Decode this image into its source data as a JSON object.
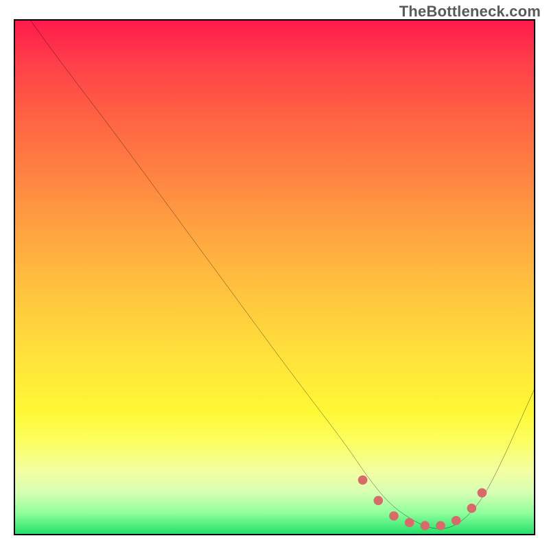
{
  "watermark": "TheBottleneck.com",
  "colors": {
    "border": "#000000",
    "curve": "#000000",
    "marker": "#d86a6a",
    "gradient_top": "#ff1a4b",
    "gradient_bottom": "#24e06a"
  },
  "chart_data": {
    "type": "line",
    "title": "",
    "xlabel": "",
    "ylabel": "",
    "xlim": [
      0,
      100
    ],
    "ylim": [
      0,
      100
    ],
    "grid": false,
    "series": [
      {
        "name": "bottleneck-curve",
        "x": [
          3,
          8,
          14,
          20,
          28,
          36,
          44,
          52,
          58,
          64,
          68,
          72,
          76,
          80,
          84,
          88,
          92,
          100
        ],
        "y": [
          100,
          93,
          85,
          77,
          66,
          55,
          44,
          33,
          25,
          17,
          11,
          6,
          3,
          1,
          1,
          4,
          10,
          28
        ]
      }
    ],
    "markers": {
      "name": "highlighted-minimum",
      "x": [
        67,
        70,
        73,
        76,
        79,
        82,
        85,
        88,
        90
      ],
      "y": [
        10.5,
        6.5,
        3.5,
        2.2,
        1.6,
        1.6,
        2.6,
        5.0,
        8.0
      ]
    }
  }
}
